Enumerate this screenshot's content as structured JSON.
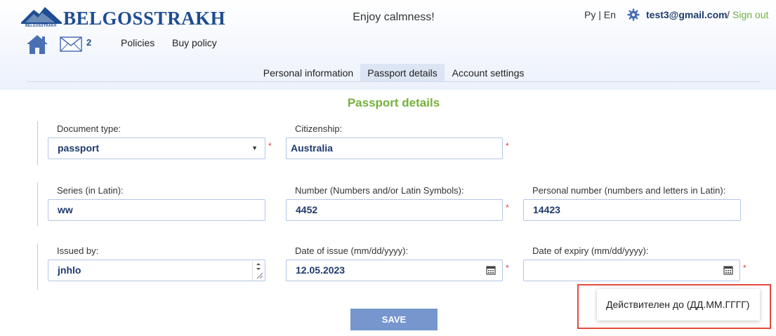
{
  "header": {
    "brand": "BELGOSSTRAKH",
    "brand_small": "BELGOSSTRAKH",
    "tagline": "Enjoy calmness!",
    "mail_count": "2",
    "nav": [
      "Policies",
      "Buy policy"
    ],
    "lang_ru": "Ру",
    "lang_sep": "|",
    "lang_en": "En",
    "user_email": "test3@gmail.com",
    "user_sep": "/",
    "sign_out": "Sign out",
    "brand_color": "#1e4d92",
    "accent_color": "#76b13b"
  },
  "tabs": [
    {
      "label": "Personal information",
      "active": false
    },
    {
      "label": "Passport details",
      "active": true
    },
    {
      "label": "Account settings",
      "active": false
    }
  ],
  "form": {
    "title": "Passport details",
    "fields": {
      "document_type": {
        "label": "Document type:",
        "value": "passport",
        "required": true
      },
      "citizenship": {
        "label": "Citizenship:",
        "value": "Australia",
        "required": true
      },
      "series": {
        "label": "Series (in Latin):",
        "value": "ww",
        "required": false
      },
      "number": {
        "label": "Number (Numbers and/or Latin Symbols):",
        "value": "4452",
        "required": true
      },
      "personal_number": {
        "label": "Personal number (numbers and letters in Latin):",
        "value": "14423",
        "required": false
      },
      "issued_by": {
        "label": "Issued by:",
        "value": "jnhlo",
        "required": false
      },
      "date_of_issue": {
        "label": "Date of issue (mm/dd/yyyy):",
        "value": "12.05.2023",
        "required": true
      },
      "date_of_expiry": {
        "label": "Date of expiry (mm/dd/yyyy):",
        "value": "",
        "required": true
      }
    },
    "required_mark": "*",
    "save_label": "SAVE"
  },
  "tooltip": {
    "text": "Действителен до (ДД.ММ.ГГГГ)"
  },
  "colors": {
    "field_border": "#b3c7e8",
    "required": "#e23c3c",
    "save_button": "#7696cd",
    "highlight_box": "#e34b3d",
    "sign_out": "#6cb43f"
  }
}
